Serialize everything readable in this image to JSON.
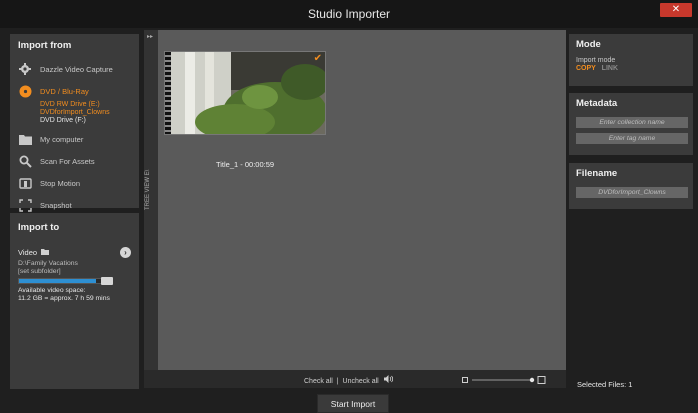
{
  "window": {
    "title": "Studio Importer",
    "close_label": "✕"
  },
  "import_from": {
    "title": "Import from",
    "sources": [
      {
        "label": "Dazzle Video Capture",
        "icon": "gear-icon"
      },
      {
        "label": "DVD / Blu-Ray",
        "icon": "disc-icon",
        "active": true
      },
      {
        "label": "My computer",
        "icon": "folder-icon"
      },
      {
        "label": "Scan For Assets",
        "icon": "magnifier-icon"
      },
      {
        "label": "Stop Motion",
        "icon": "stop-motion-icon"
      },
      {
        "label": "Snapshot",
        "icon": "snapshot-icon"
      }
    ],
    "dvd_subitems": [
      {
        "label": "DVD RW Drive (E:)",
        "color": "orange"
      },
      {
        "label": "DVDforImport_Clowns",
        "color": "orange"
      },
      {
        "label": "DVD Drive (F:)",
        "color": "white"
      }
    ]
  },
  "import_to": {
    "title": "Import to",
    "video_label": "Video",
    "path": "D:\\Family Vacations",
    "subfolder": "[set subfolder]",
    "space_label": "Available video space:",
    "space_value": "11.2 GB = approx. 7 h 59 mins"
  },
  "tree_view_label": "TREE VIEW E\\",
  "clip": {
    "caption": "Title_1 - 00:00:59"
  },
  "bottom": {
    "check_all": "Check all",
    "separator": "|",
    "uncheck_all": "Uncheck all"
  },
  "mode": {
    "title": "Mode",
    "sub": "Import mode",
    "copy": "COPY",
    "link": "LINK"
  },
  "metadata": {
    "title": "Metadata",
    "collection_placeholder": "Enter collection name",
    "tag_placeholder": "Enter tag name"
  },
  "filename": {
    "title": "Filename",
    "value": "DVDforImport_Clowns"
  },
  "selected_files": "Selected Files: 1",
  "start_import": "Start Import",
  "colors": {
    "accent": "#f28d1f",
    "progress": "#2d8fd2",
    "close": "#c7382c"
  },
  "space_fraction": 0.88
}
